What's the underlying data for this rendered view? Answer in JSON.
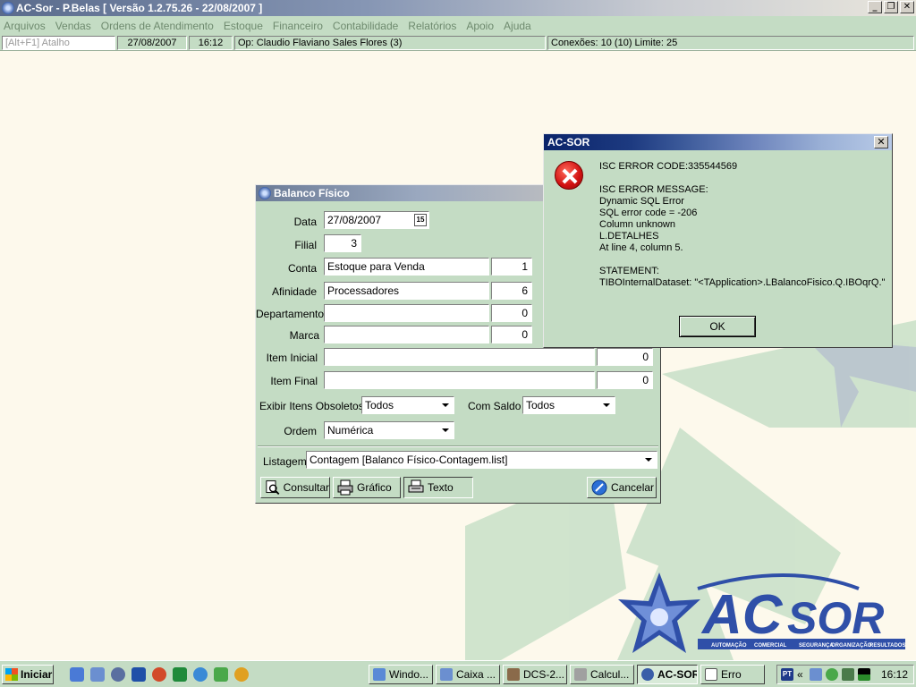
{
  "window": {
    "title": "AC-Sor - P.Belas  [ Versão 1.2.75.26 - 22/08/2007 ]",
    "minimize": "_",
    "restore": "❐",
    "close": "✕"
  },
  "menu": [
    "Arquivos",
    "Vendas",
    "Ordens de Atendimento",
    "Estoque",
    "Financeiro",
    "Contabilidade",
    "Relatórios",
    "Apoio",
    "Ajuda"
  ],
  "status": {
    "shortcut_placeholder": "[Alt+F1] Atalho",
    "date": "27/08/2007",
    "time": "16:12",
    "operator": "Op: Claudio Flaviano Sales Flores  (3)",
    "connections": "Conexões: 10 (10)  Limite: 25"
  },
  "balanco": {
    "title": "Balanco Físico",
    "labels": {
      "data": "Data",
      "filial": "Filial",
      "conta": "Conta",
      "afinidade": "Afinidade",
      "departamento": "Departamento",
      "marca": "Marca",
      "item_inicial": "Item Inicial",
      "item_final": "Item Final",
      "exibir": "Exibir Itens Obsoletos",
      "com_saldo": "Com Saldo",
      "ordem": "Ordem",
      "listagem": "Listagem"
    },
    "values": {
      "data": "27/08/2007",
      "calendar": "15",
      "filial": "3",
      "conta_name": "Estoque para Venda",
      "conta_code": "1",
      "afinidade_name": "Processadores",
      "afinidade_code": "6",
      "departamento_name": "",
      "departamento_code": "0",
      "marca_name": "",
      "marca_code": "0",
      "item_inicial_name": "",
      "item_inicial_code": "0",
      "item_final_name": "",
      "item_final_code": "0",
      "exibir": "Todos",
      "com_saldo": "Todos",
      "ordem": "Numérica",
      "listagem": "Contagem [Balanco Físico-Contagem.list]"
    },
    "buttons": {
      "consultar": "Consultar",
      "grafico": "Gráfico",
      "texto": "Texto",
      "cancelar": "Cancelar"
    }
  },
  "error": {
    "title": "AC-SOR",
    "message": "ISC ERROR CODE:335544569\n\nISC ERROR MESSAGE:\nDynamic SQL Error\nSQL error code = -206\nColumn unknown\nL.DETALHES\nAt line 4, column 5.\n\nSTATEMENT:\nTIBOInternalDataset: \"<TApplication>.LBalancoFisico.Q.IBOqrQ.\"",
    "ok": "OK",
    "close": "✕"
  },
  "logo": {
    "brand_ac": "AC",
    "brand_sor": "SOR",
    "tagline": [
      "AUTOMAÇÃO",
      "COMERCIAL",
      "SEGURANÇA",
      "ORGANIZAÇÃO",
      "RESULTADOS"
    ]
  },
  "taskbar": {
    "start": "Iniciar",
    "tasks": [
      "Windo...",
      "Caixa ...",
      "DCS-2...",
      "Calcul...",
      "AC-SOR",
      "Erro"
    ],
    "tray_lang": "PT",
    "tray_chevron": "«",
    "clock": "16:12"
  },
  "colors": {
    "panel": "#c4dcc4",
    "desktop": "#fdf9ec",
    "logo_blue": "#2f4fa8"
  }
}
